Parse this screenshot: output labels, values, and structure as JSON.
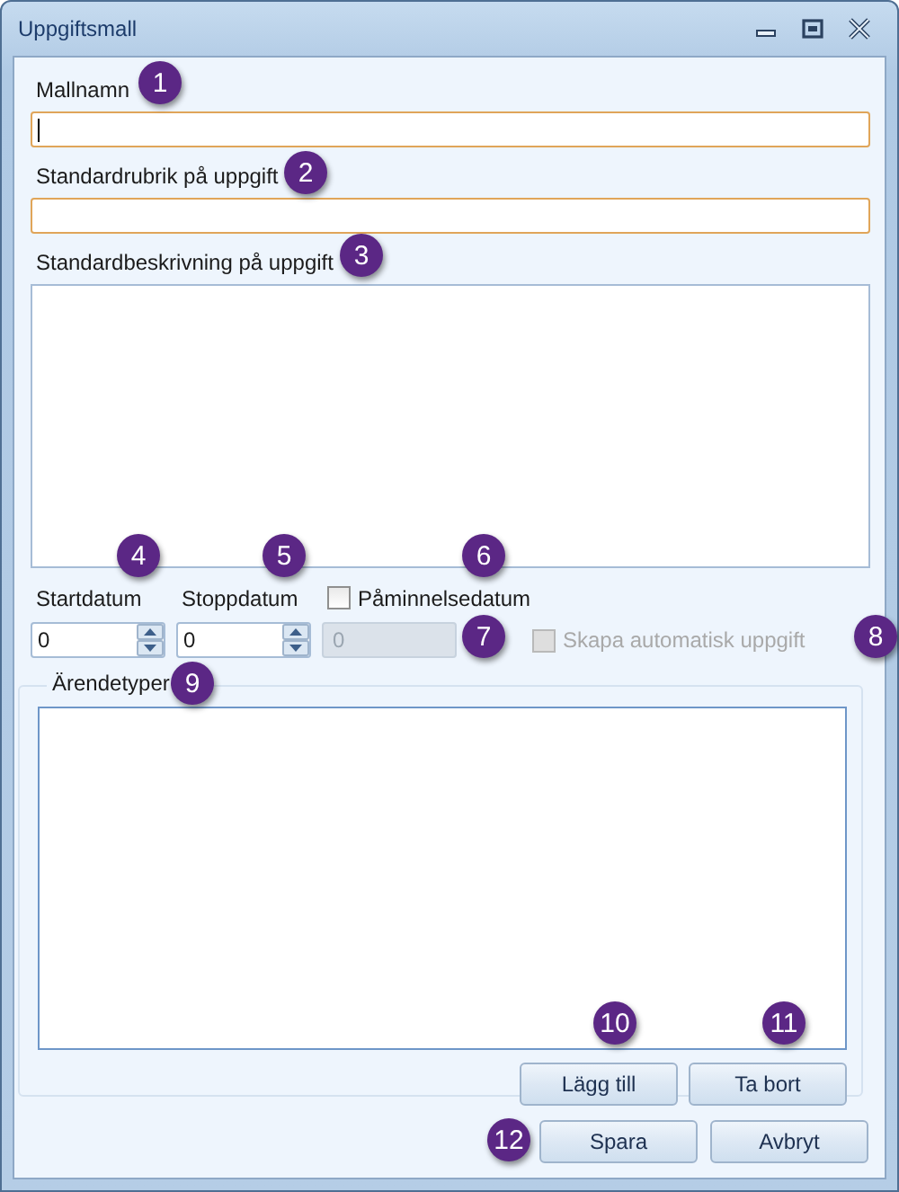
{
  "window": {
    "title": "Uppgiftsmall"
  },
  "name_field": {
    "label": "Mallnamn",
    "focused": true
  },
  "heading_field": {
    "label": "Standardrubrik på uppgift",
    "focused": false
  },
  "description_field": {
    "label": "Standardbeskrivning på uppgift"
  },
  "start_date": {
    "label": "Startdatum",
    "value": "0"
  },
  "stop_date": {
    "label": "Stoppdatum",
    "value": "0"
  },
  "reminder": {
    "label": "Påminnelsedatum",
    "checked": false,
    "value": "0",
    "disabled": true
  },
  "auto_task": {
    "label": "Skapa automatisk uppgift",
    "checked": false,
    "disabled": true
  },
  "case_types": {
    "title": "Ärendetyper",
    "buttons": [
      "Lägg till",
      "Ta bort"
    ]
  },
  "buttons": [
    "Spara",
    "Avbryt"
  ],
  "badges": [
    "1",
    "2",
    "3",
    "4",
    "5",
    "6",
    "7",
    "8",
    "9",
    "10",
    "11",
    "12"
  ]
}
